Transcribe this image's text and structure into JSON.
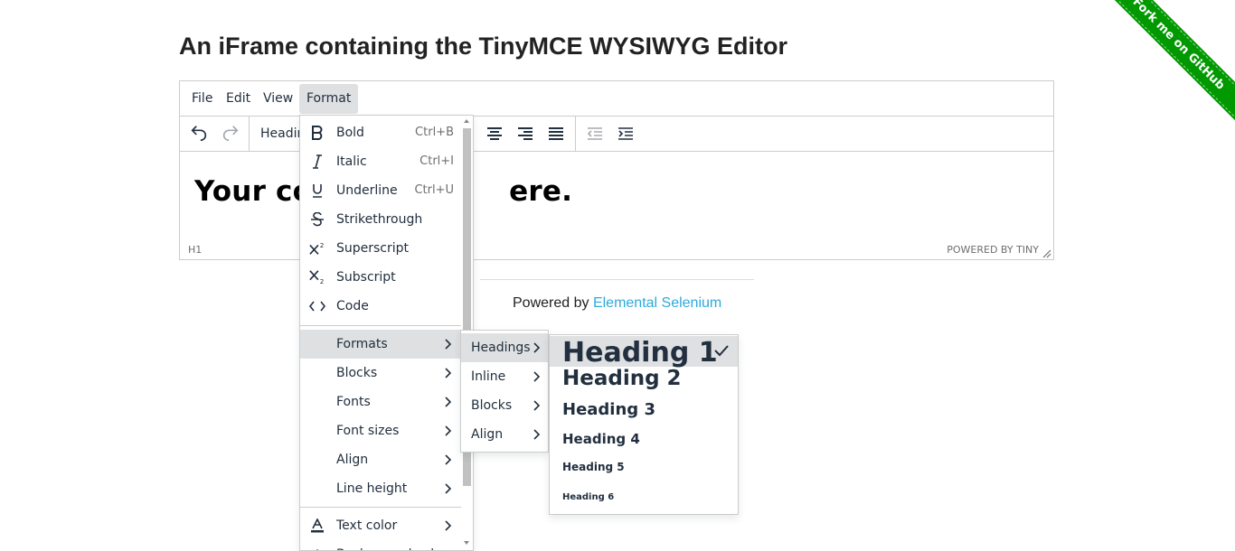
{
  "page": {
    "title": "An iFrame containing the TinyMCE WYSIWYG Editor"
  },
  "ribbon": {
    "text": "Fork me on GitHub",
    "color": "#009900"
  },
  "editor": {
    "menubar": [
      {
        "label": "File",
        "active": false
      },
      {
        "label": "Edit",
        "active": false
      },
      {
        "label": "View",
        "active": false
      },
      {
        "label": "Format",
        "active": true
      }
    ],
    "toolbar": {
      "blocks_value": "Headin",
      "icons": [
        "undo-icon",
        "redo-icon",
        "align-center-icon",
        "align-right-icon",
        "align-justify-icon",
        "outdent-icon",
        "indent-icon"
      ]
    },
    "content": {
      "text_left": "Your co",
      "text_right": "ere."
    },
    "statusbar": {
      "path": "H1",
      "brand": "POWERED BY TINY"
    }
  },
  "footer": {
    "prefix": "Powered by ",
    "link_text": "Elemental Selenium",
    "link_color": "#2daadb"
  },
  "format_menu": {
    "items": [
      {
        "label": "Bold",
        "icon": "bold-icon",
        "shortcut": "Ctrl+B"
      },
      {
        "label": "Italic",
        "icon": "italic-icon",
        "shortcut": "Ctrl+I"
      },
      {
        "label": "Underline",
        "icon": "underline-icon",
        "shortcut": "Ctrl+U"
      },
      {
        "label": "Strikethrough",
        "icon": "strikethrough-icon"
      },
      {
        "label": "Superscript",
        "icon": "superscript-icon"
      },
      {
        "label": "Subscript",
        "icon": "subscript-icon"
      },
      {
        "label": "Code",
        "icon": "code-icon"
      }
    ],
    "submenus": [
      {
        "label": "Formats",
        "highlighted": true
      },
      {
        "label": "Blocks"
      },
      {
        "label": "Fonts"
      },
      {
        "label": "Font sizes"
      },
      {
        "label": "Align"
      },
      {
        "label": "Line height"
      }
    ],
    "more": [
      {
        "label": "Text color",
        "icon": "text-color-icon"
      },
      {
        "label": "Background color",
        "icon": "background-color-icon"
      }
    ]
  },
  "formats_submenu": {
    "items": [
      {
        "label": "Headings",
        "highlighted": true
      },
      {
        "label": "Inline"
      },
      {
        "label": "Blocks"
      },
      {
        "label": "Align"
      }
    ]
  },
  "headings_submenu": {
    "items": [
      {
        "label": "Heading 1",
        "checked": true
      },
      {
        "label": "Heading 2"
      },
      {
        "label": "Heading 3"
      },
      {
        "label": "Heading 4"
      },
      {
        "label": "Heading 5"
      },
      {
        "label": "Heading 6"
      }
    ]
  }
}
